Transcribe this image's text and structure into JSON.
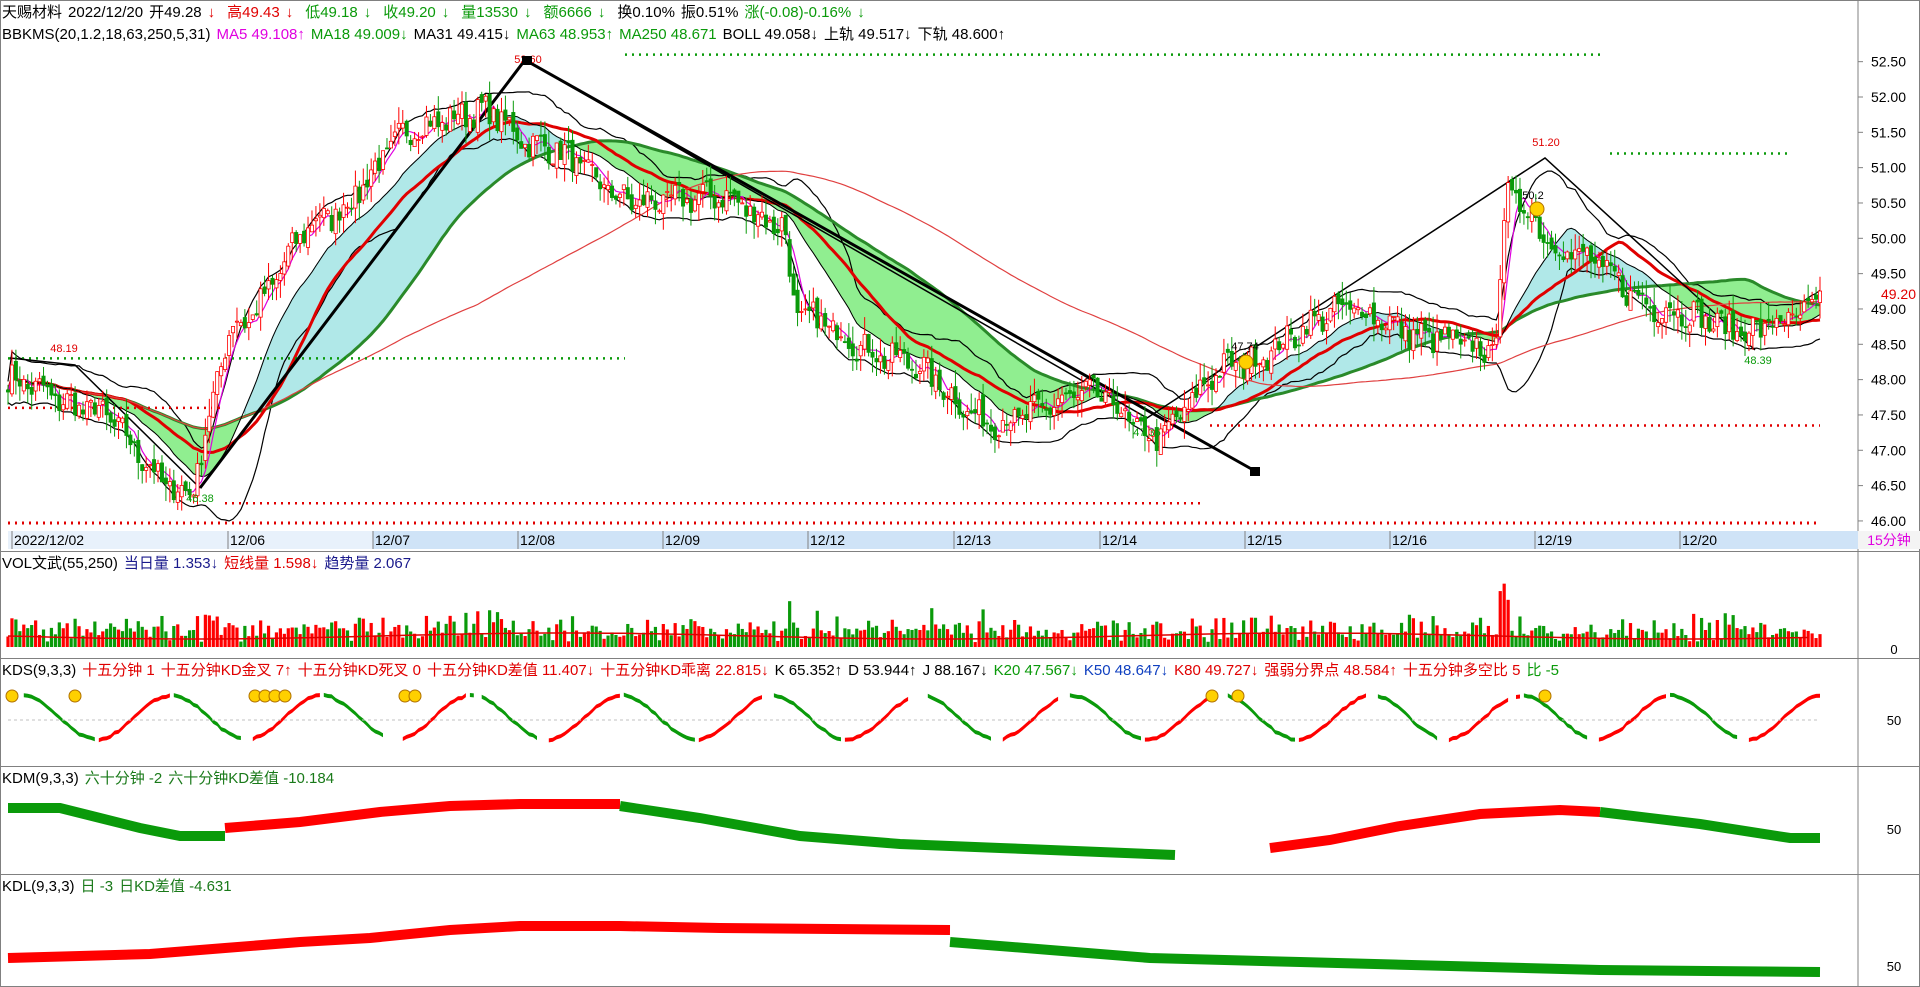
{
  "header": {
    "stock_name": "天赐材料",
    "date": "2022/12/20",
    "open": "开49.28",
    "open_arrow": "↓",
    "high": "高49.43",
    "high_arrow": "↓",
    "low": "低49.18",
    "low_arrow": "↓",
    "close": "收49.20",
    "close_arrow": "↓",
    "volume": "量13530",
    "volume_arrow": "↓",
    "amount": "额6666",
    "amount_arrow": "↓",
    "turnover": "换0.10%",
    "amplitude": "振0.51%",
    "change": "涨(-0.08)-0.16%",
    "change_arrow": "↓"
  },
  "main_indicator": {
    "name": "BBKMS(20,1.2,18,63,250,5,31)",
    "ma5": "MA5 49.108↑",
    "ma18": "MA18 49.009↓",
    "ma31": "MA31 49.415↓",
    "ma63": "MA63 48.953↑",
    "ma250": "MA250 48.671",
    "boll": "BOLL 49.058↓",
    "upper": "上轨 49.517↓",
    "lower": "下轨 48.600↑"
  },
  "price_axis": {
    "ticks": [
      "52.50",
      "52.00",
      "51.50",
      "51.00",
      "50.50",
      "50.00",
      "49.50",
      "49.00",
      "48.50",
      "48.00",
      "47.50",
      "47.00",
      "46.50",
      "46.00"
    ],
    "current": "49.20"
  },
  "price_labels": {
    "p1": "48.19",
    "p2": "46.38",
    "p3": "52.60",
    "p4": "47.35",
    "p5": "47.74",
    "p6": "51.20",
    "p7": "50.2",
    "p8": "48.39"
  },
  "date_axis": {
    "labels": [
      "2022/12/02",
      "12/06",
      "12/07",
      "12/08",
      "12/09",
      "12/12",
      "12/13",
      "12/14",
      "12/15",
      "12/16",
      "12/19",
      "12/20"
    ],
    "period": "15分钟"
  },
  "vol_panel": {
    "name": "VOL文武(55,250)",
    "day_vol": "当日量 1.353↓",
    "short_vol": "短线量 1.598↓",
    "trend_vol": "趋势量 2.067",
    "axis_zero": "0"
  },
  "kds_panel": {
    "name": "KDS(9,3,3)",
    "t1": "十五分钟 1",
    "t2": "十五分钟KD金叉 7↑",
    "t3": "十五分钟KD死叉 0",
    "t4": "十五分钟KD差值 11.407↓",
    "t5": "十五分钟KD乖离 22.815↓",
    "k": "K 65.352↑",
    "d": "D 53.944↑",
    "j": "J 88.167↓",
    "k20": "K20 47.567↓",
    "k50": "K50 48.647↓",
    "k80": "K80 49.727↓",
    "strong": "强弱分界点 48.584↑",
    "ratio": "十五分钟多空比 5",
    "ratio2": "比 -5",
    "axis": "50"
  },
  "kdm_panel": {
    "name": "KDM(9,3,3)",
    "t1": "六十分钟 -2",
    "t2": "六十分钟KD差值 -10.184",
    "axis": "50"
  },
  "kdl_panel": {
    "name": "KDL(9,3,3)",
    "t1": "日 -3",
    "t2": "日KD差值 -4.631",
    "axis": "50"
  },
  "colors": {
    "up": "#ff0000",
    "down": "#0a9a0a",
    "cloud_up": "#90ee90",
    "cloud_down": "#b0e8e8"
  },
  "chart_data": {
    "type": "candlestick",
    "symbol": "天赐材料",
    "interval": "15分钟",
    "ylim": [
      45.9,
      52.75
    ],
    "x_categories": [
      "2022/12/02",
      "12/06",
      "12/07",
      "12/08",
      "12/09",
      "12/12",
      "12/13",
      "12/14",
      "12/15",
      "12/16",
      "12/19",
      "12/20"
    ],
    "anchors": [
      [
        0,
        48.0
      ],
      [
        20,
        47.6
      ],
      [
        45,
        46.4
      ],
      [
        58,
        48.8
      ],
      [
        80,
        50.3
      ],
      [
        105,
        51.6
      ],
      [
        120,
        51.8
      ],
      [
        135,
        51.3
      ],
      [
        160,
        50.5
      ],
      [
        180,
        50.6
      ],
      [
        196,
        50.2
      ],
      [
        200,
        48.9
      ],
      [
        225,
        48.3
      ],
      [
        250,
        47.4
      ],
      [
        275,
        47.8
      ],
      [
        290,
        47.2
      ],
      [
        310,
        48.2
      ],
      [
        340,
        49.0
      ],
      [
        360,
        48.6
      ],
      [
        376,
        48.4
      ],
      [
        380,
        50.6
      ],
      [
        395,
        49.8
      ],
      [
        420,
        49.0
      ],
      [
        440,
        48.7
      ],
      [
        455,
        48.9
      ],
      [
        460,
        49.2
      ]
    ],
    "annotations": {
      "high": 52.6,
      "low_left": 46.38,
      "left_peak": 48.19,
      "mid_low": 47.35,
      "low_right": 47.74,
      "right_high": 51.2,
      "right_low": 48.39,
      "smile": 50.2
    }
  }
}
